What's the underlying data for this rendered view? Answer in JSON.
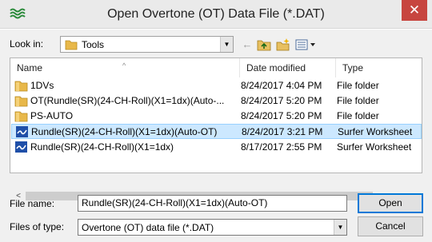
{
  "window": {
    "title": "Open Overtone (OT) Data File (*.DAT)",
    "close_glyph": "✕",
    "app_icon": "waves-app-icon"
  },
  "look_in": {
    "label": "Look in:",
    "value": "Tools",
    "dropdown_glyph": "▼"
  },
  "toolbar": {
    "back_glyph": "←",
    "up_glyph": "⬆",
    "new_folder_glyph": "✦",
    "view_glyph": "☷▾"
  },
  "columns": {
    "name": "Name",
    "date": "Date modified",
    "type": "Type",
    "sort_glyph": "^"
  },
  "files": [
    {
      "name": "1DVs",
      "date": "8/24/2017 4:04 PM",
      "type": "File folder",
      "icon": "folder"
    },
    {
      "name": "OT(Rundle(SR)(24-CH-Roll)(X1=1dx)(Auto-...",
      "date": "8/24/2017 5:20 PM",
      "type": "File folder",
      "icon": "folder"
    },
    {
      "name": "PS-AUTO",
      "date": "8/24/2017 5:20 PM",
      "type": "File folder",
      "icon": "folder"
    },
    {
      "name": "Rundle(SR)(24-CH-Roll)(X1=1dx)(Auto-OT)",
      "date": "8/24/2017 3:21 PM",
      "type": "Surfer Worksheet",
      "icon": "worksheet",
      "selected": true
    },
    {
      "name": "Rundle(SR)(24-CH-Roll)(X1=1dx)",
      "date": "8/17/2017 2:55 PM",
      "type": "Surfer Worksheet",
      "icon": "worksheet"
    }
  ],
  "scrollbar": {
    "left_glyph": "<",
    "right_glyph": ">"
  },
  "file_name": {
    "label": "File name:",
    "value": "Rundle(SR)(24-CH-Roll)(X1=1dx)(Auto-OT)"
  },
  "file_type": {
    "label": "Files of type:",
    "value": "Overtone (OT) data file (*.DAT)",
    "dropdown_glyph": "▼"
  },
  "buttons": {
    "open": "Open",
    "cancel": "Cancel"
  },
  "colors": {
    "selection": "#cce8ff",
    "close_button": "#c7453f",
    "folder": "#e8b84a",
    "worksheet": "#1f4fa8"
  }
}
